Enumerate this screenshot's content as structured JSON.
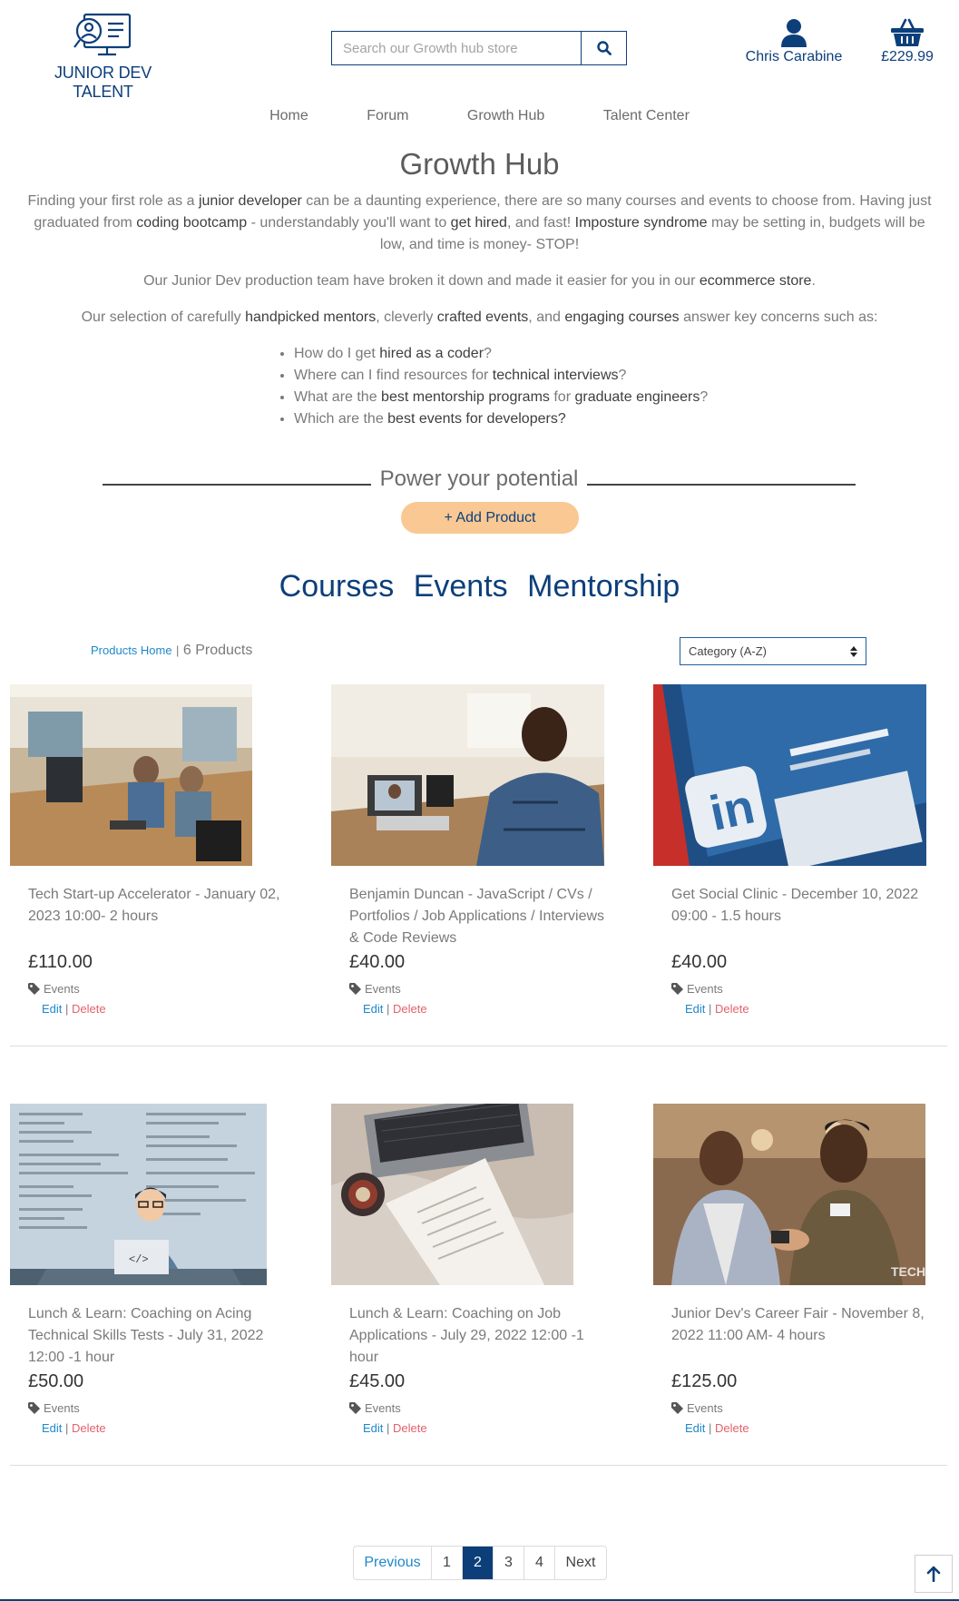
{
  "brand": {
    "name": "JUNIOR DEV TALENT",
    "logo_icon": "monitor-person-icon"
  },
  "search": {
    "placeholder": "Search our Growth hub store",
    "icon": "search-icon"
  },
  "account": {
    "name": "Chris Carabine",
    "icon": "user-icon"
  },
  "cart": {
    "total": "£229.99",
    "icon": "basket-icon"
  },
  "nav": [
    {
      "label": "Home"
    },
    {
      "label": "Forum"
    },
    {
      "label": "Growth Hub"
    },
    {
      "label": "Talent Center"
    }
  ],
  "page": {
    "title": "Growth Hub",
    "intro1": {
      "t1": "Finding your first role as a ",
      "b1": "junior developer",
      "t2": " can be a daunting experience, there are so many courses and events to choose from. Having just graduated from ",
      "b2": "coding bootcamp",
      "t3": " - understandably you'll want to ",
      "b3": "get hired",
      "t4": ", and fast! ",
      "b4": "Imposture syndrome",
      "t5": " may be setting in, budgets will be low, and time is money- STOP!"
    },
    "intro2": {
      "t1": "Our Junior Dev production team have broken it down and made it easier for you in our ",
      "b1": "ecommerce store",
      "t2": "."
    },
    "intro3": {
      "t1": "Our selection of carefully ",
      "b1": "handpicked mentors",
      "t2": ", cleverly ",
      "b2": "crafted events",
      "t3": ", and ",
      "b3": "engaging courses",
      "t4": " answer key concerns such as:"
    },
    "concerns": [
      {
        "t1": "How do I get ",
        "b1": "hired as a coder",
        "t2": "?"
      },
      {
        "t1": "Where can I find resources for ",
        "b1": "technical interviews",
        "t2": "?"
      },
      {
        "t1": "What are the ",
        "b1": "best mentorship programs",
        "t2": " for ",
        "b2": "graduate engineers",
        "t3": "?"
      },
      {
        "t1": "Which are the ",
        "b1": "best events for developers?",
        "t2": ""
      }
    ]
  },
  "power": {
    "heading": "Power your potential",
    "add_button": "+ Add Product"
  },
  "categories": [
    "Courses",
    "Events",
    "Mentorship"
  ],
  "toolbar": {
    "products_home": "Products Home",
    "separator": "|",
    "count": "6 Products",
    "sort_selected": "Category (A-Z)"
  },
  "products": [
    {
      "title": "Tech Start-up Accelerator - January 02, 2023 10:00- 2 hours",
      "price": "£110.00",
      "category": "Events",
      "edit": "Edit",
      "sep": "|",
      "delete": "Delete"
    },
    {
      "title": "Benjamin Duncan - JavaScript / CVs / Portfolios / Job Applications / Interviews & Code Reviews",
      "price": "£40.00",
      "category": "Events",
      "edit": "Edit",
      "sep": "|",
      "delete": "Delete"
    },
    {
      "title": "Get Social Clinic - December 10, 2022 09:00 - 1.5 hours",
      "price": "£40.00",
      "category": "Events",
      "edit": "Edit",
      "sep": "|",
      "delete": "Delete"
    },
    {
      "title": "Lunch & Learn: Coaching on Acing Technical Skills Tests - July 31, 2022 12:00 -1 hour",
      "price": "£50.00",
      "category": "Events",
      "edit": "Edit",
      "sep": "|",
      "delete": "Delete"
    },
    {
      "title": "Lunch & Learn: Coaching on Job Applications - July 29, 2022 12:00 -1 hour",
      "price": "£45.00",
      "category": "Events",
      "edit": "Edit",
      "sep": "|",
      "delete": "Delete"
    },
    {
      "title": "Junior Dev's Career Fair - November 8, 2022 11:00 AM- 4 hours",
      "price": "£125.00",
      "category": "Events",
      "edit": "Edit",
      "sep": "|",
      "delete": "Delete"
    }
  ],
  "pagination": {
    "previous": "Previous",
    "pages": [
      "1",
      "2",
      "3",
      "4"
    ],
    "current": "2",
    "next": "Next"
  },
  "back_to_top": {
    "icon": "arrow-up-icon"
  },
  "colors": {
    "brand": "#0c3f7a",
    "accent": "#f9c893",
    "link": "#1e88c9",
    "delete": "#e4606d"
  }
}
